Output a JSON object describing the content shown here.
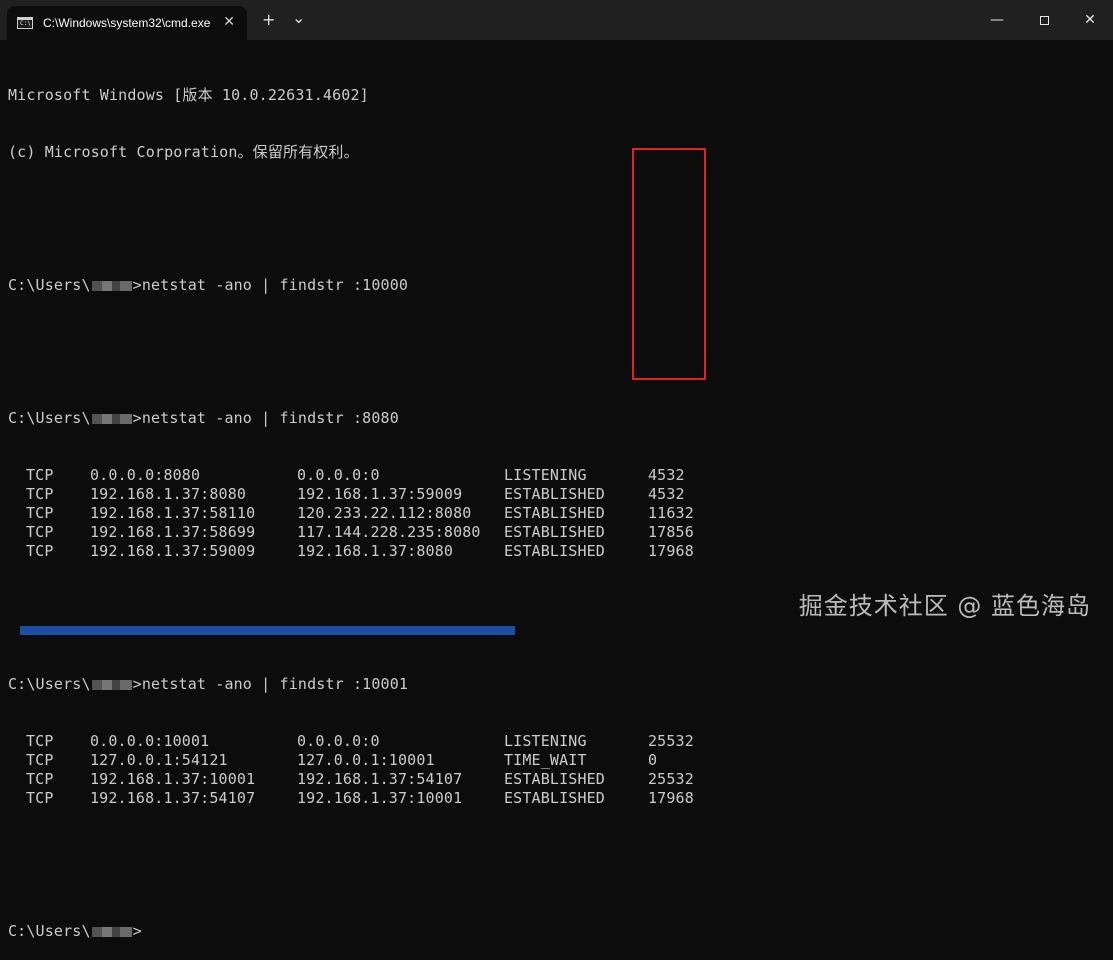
{
  "titlebar": {
    "tab_title": "C:\\Windows\\system32\\cmd.exe",
    "tab_icon": "C:\\",
    "close_tab_glyph": "✕",
    "new_tab_glyph": "+",
    "dropdown_glyph": "⌄",
    "minimize_glyph": "—",
    "close_window_glyph": "✕"
  },
  "terminal": {
    "header_line1": "Microsoft Windows [版本 10.0.22631.4602]",
    "header_line2": "(c) Microsoft Corporation。保留所有权利。",
    "prompt_prefix": "C:\\Users\\",
    "commands": [
      ">netstat -ano | findstr :10000",
      ">netstat -ano | findstr :8080",
      ">netstat -ano | findstr :10001",
      ">"
    ],
    "block_8080": [
      [
        "TCP",
        "0.0.0.0:8080",
        "0.0.0.0:0",
        "LISTENING",
        "4532"
      ],
      [
        "TCP",
        "192.168.1.37:8080",
        "192.168.1.37:59009",
        "ESTABLISHED",
        "4532"
      ],
      [
        "TCP",
        "192.168.1.37:58110",
        "120.233.22.112:8080",
        "ESTABLISHED",
        "11632"
      ],
      [
        "TCP",
        "192.168.1.37:58699",
        "117.144.228.235:8080",
        "ESTABLISHED",
        "17856"
      ],
      [
        "TCP",
        "192.168.1.37:59009",
        "192.168.1.37:8080",
        "ESTABLISHED",
        "17968"
      ]
    ],
    "block_10001": [
      [
        "TCP",
        "0.0.0.0:10001",
        "0.0.0.0:0",
        "LISTENING",
        "25532"
      ],
      [
        "TCP",
        "127.0.0.1:54121",
        "127.0.0.1:10001",
        "TIME_WAIT",
        "0"
      ],
      [
        "TCP",
        "192.168.1.37:10001",
        "192.168.1.37:54107",
        "ESTABLISHED",
        "25532"
      ],
      [
        "TCP",
        "192.168.1.37:54107",
        "192.168.1.37:10001",
        "ESTABLISHED",
        "17968"
      ]
    ]
  },
  "watermark": "掘金技术社区 @ 蓝色海岛",
  "colors": {
    "terminal_bg": "#0c0c0c",
    "terminal_text": "#cccccc",
    "titlebar_bg": "#202020",
    "highlight_border": "#e0202a"
  }
}
